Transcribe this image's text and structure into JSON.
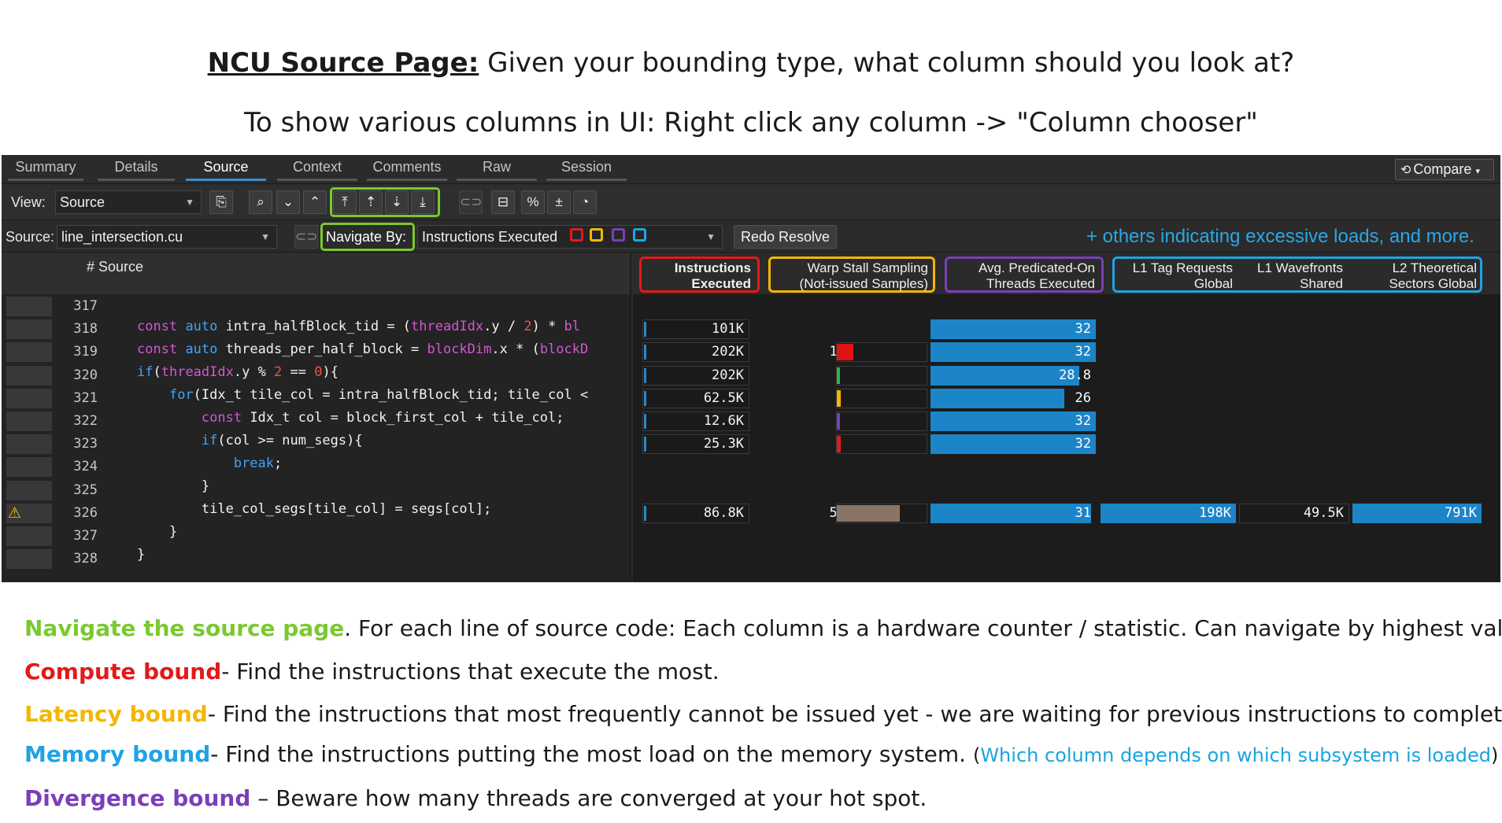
{
  "heading": {
    "title_bold": "NCU Source Page:",
    "title_rest": " Given your bounding type, what column should you look at?",
    "subtitle": "To show various columns in UI:  Right click any column -> \"Column chooser\""
  },
  "tabs": [
    "Summary",
    "Details",
    "Source",
    "Context",
    "Comments",
    "Raw",
    "Session"
  ],
  "active_tab": "Source",
  "compare_label": "Compare",
  "toolbar": {
    "view_label": "View:",
    "view_value": "Source",
    "icons": [
      "copy-icon",
      "search-icon",
      "chevron-down-icon",
      "chevron-up-icon",
      "navigate-top-icon",
      "sort-up-icon",
      "sort-down-icon",
      "navigate-bottom-icon",
      "link-icon",
      "collapse-icon",
      "percent-icon",
      "plus-minus-icon",
      "pie-chart-icon"
    ]
  },
  "sourcebar": {
    "source_label": "Source:",
    "source_file": "line_intersection.cu",
    "navigate_by_label": "Navigate By:",
    "navigate_by_value": "Instructions Executed",
    "redo_resolve": "Redo Resolve",
    "others_note": "+ others indicating excessive loads, and more."
  },
  "colors": {
    "compute": "#e21a1a",
    "latency": "#f2b705",
    "divergence": "#7a3fb8",
    "memory": "#1fa3e4",
    "navigate": "#7ac92f",
    "bar_blue": "#1c85c8"
  },
  "columns": {
    "source": "# Source",
    "instructions_executed": [
      "Instructions",
      "Executed"
    ],
    "warp_stall": [
      "Warp Stall Sampling",
      "(Not-issued Samples)"
    ],
    "avg_predicated": [
      "Avg. Predicated-On",
      "Threads Executed"
    ],
    "l1_tag": [
      "L1 Tag Requests",
      "Global"
    ],
    "l1_wavefronts": [
      "L1 Wavefronts",
      "Shared"
    ],
    "l2_sectors": [
      "L2 Theoretical",
      "Sectors Global"
    ]
  },
  "rows": [
    {
      "line": "317",
      "warn": false,
      "instr": "",
      "stall": "",
      "stall_frac": 0,
      "stall_color": "",
      "pred": "",
      "pred_frac": 0,
      "l1tag": "",
      "l1wave": "",
      "l2": ""
    },
    {
      "line": "318",
      "warn": false,
      "instr": "101K",
      "stall": "",
      "stall_frac": 0,
      "stall_color": "",
      "pred": "32",
      "pred_frac": 1.0,
      "l1tag": "",
      "l1wave": "",
      "l2": ""
    },
    {
      "line": "319",
      "warn": false,
      "instr": "202K",
      "stall": "14",
      "stall_frac": 0.18,
      "stall_color": "#e01212",
      "pred": "32",
      "pred_frac": 1.0,
      "l1tag": "",
      "l1wave": "",
      "l2": ""
    },
    {
      "line": "320",
      "warn": false,
      "instr": "202K",
      "stall": "2",
      "stall_frac": 0.03,
      "stall_color": "#2bb64a",
      "pred": "28.8",
      "pred_frac": 0.9,
      "l1tag": "",
      "l1wave": "",
      "l2": ""
    },
    {
      "line": "321",
      "warn": false,
      "instr": "62.5K",
      "stall": "3",
      "stall_frac": 0.04,
      "stall_color": "#f2b705",
      "pred": "26",
      "pred_frac": 0.81,
      "l1tag": "",
      "l1wave": "",
      "l2": ""
    },
    {
      "line": "322",
      "warn": false,
      "instr": "12.6K",
      "stall": "1",
      "stall_frac": 0.02,
      "stall_color": "#7a3fb8",
      "pred": "32",
      "pred_frac": 1.0,
      "l1tag": "",
      "l1wave": "",
      "l2": ""
    },
    {
      "line": "323",
      "warn": false,
      "instr": "25.3K",
      "stall": "3",
      "stall_frac": 0.04,
      "stall_color": "#d92020",
      "pred": "32",
      "pred_frac": 1.0,
      "l1tag": "",
      "l1wave": "",
      "l2": ""
    },
    {
      "line": "324",
      "warn": false,
      "instr": "",
      "stall": "",
      "stall_frac": 0,
      "stall_color": "",
      "pred": "",
      "pred_frac": 0,
      "l1tag": "",
      "l1wave": "",
      "l2": ""
    },
    {
      "line": "325",
      "warn": false,
      "instr": "",
      "stall": "",
      "stall_frac": 0,
      "stall_color": "",
      "pred": "",
      "pred_frac": 0,
      "l1tag": "",
      "l1wave": "",
      "l2": ""
    },
    {
      "line": "326",
      "warn": true,
      "instr": "86.8K",
      "stall": "50",
      "stall_frac": 0.7,
      "stall_color": "#8a7465",
      "pred": "31",
      "pred_frac": 0.97,
      "l1tag": "198K",
      "l1wave": "49.5K",
      "l2": "791K"
    },
    {
      "line": "327",
      "warn": false,
      "instr": "",
      "stall": "",
      "stall_frac": 0,
      "stall_color": "",
      "pred": "",
      "pred_frac": 0,
      "l1tag": "",
      "l1wave": "",
      "l2": ""
    },
    {
      "line": "328",
      "warn": false,
      "instr": "",
      "stall": "",
      "stall_frac": 0,
      "stall_color": "",
      "pred": "",
      "pred_frac": 0,
      "l1tag": "",
      "l1wave": "",
      "l2": ""
    }
  ],
  "notes": [
    {
      "lead": "Navigate the source page",
      "lead_color": "#7ac92f",
      "text": ". For each line of source code: Each column is a hardware counter / statistic. Can navigate by highest values."
    },
    {
      "lead": "Compute bound",
      "lead_color": "#e21a1a",
      "text": "- Find the instructions that execute the most."
    },
    {
      "lead": "Latency bound",
      "lead_color": "#f2b705",
      "text": "- Find the instructions that most frequently cannot be issued yet - we are waiting for previous instructions to complete."
    },
    {
      "lead": "Memory bound",
      "lead_color": "#1fa3e4",
      "text": "- Find the instructions putting the most load on the memory system. ",
      "paren_open": "(",
      "link": "Which column depends on which subsystem is loaded",
      "paren_close": ")"
    },
    {
      "lead": "Divergence bound",
      "lead_color": "#7a3fb8",
      "text": " – Beware how many threads are converged at your hot spot."
    }
  ]
}
